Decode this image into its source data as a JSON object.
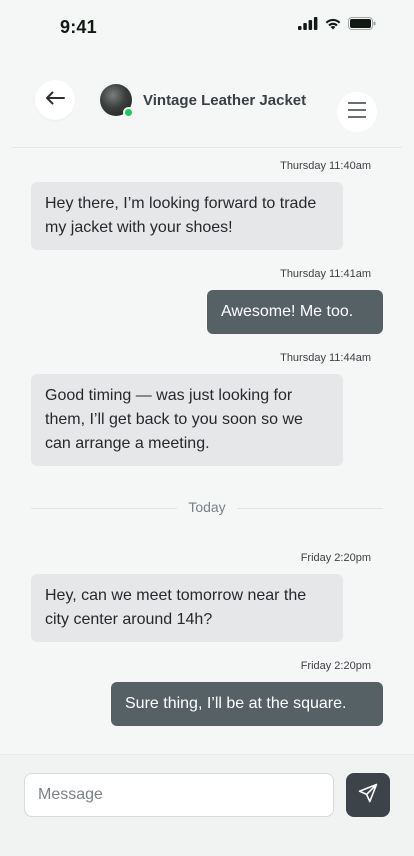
{
  "status_bar": {
    "time": "9:41",
    "icons": [
      "signal-icon",
      "wifi-icon",
      "battery-icon"
    ]
  },
  "header": {
    "title": "Vintage Leather Jacket",
    "back_icon": "arrow-left-icon",
    "menu_icon": "hamburger-menu-icon",
    "online_status_color": "#22c55e"
  },
  "messages": [
    {
      "direction": "incoming",
      "timestamp": "Thursday 11:40am",
      "text": "Hey there, I’m looking forward to trade my jacket with your shoes!"
    },
    {
      "direction": "outgoing",
      "timestamp": "Thursday 11:41am",
      "text": "Awesome! Me too."
    },
    {
      "direction": "incoming",
      "timestamp": "Thursday 11:44am",
      "text": "Good timing — was just looking for them, I’ll get back to you soon so we can arrange a meeting."
    },
    {
      "direction": "incoming",
      "timestamp": "Friday 2:20pm",
      "text": "Hey, can we meet tomorrow near the city center around 14h?"
    },
    {
      "direction": "outgoing",
      "timestamp": "Friday 2:20pm",
      "text": "Sure thing, I’ll be at the square."
    }
  ],
  "day_divider": {
    "label": "Today"
  },
  "composer": {
    "placeholder": "Message",
    "value": "",
    "send_icon": "send-icon"
  },
  "colors": {
    "incoming_bubble": "#e6e7e8",
    "outgoing_bubble": "#566166",
    "send_button": "#3c444a"
  }
}
